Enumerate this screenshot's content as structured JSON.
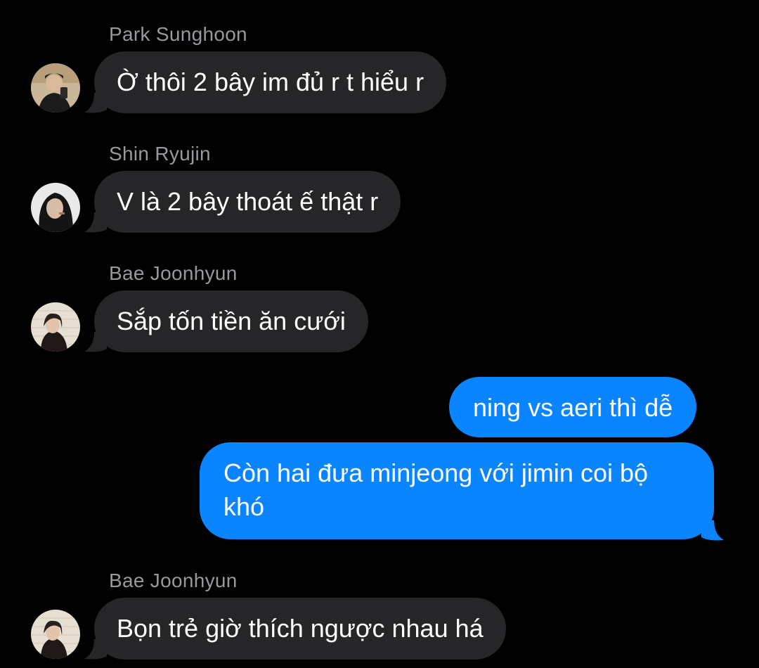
{
  "messages": [
    {
      "sender": "Park Sunghoon",
      "text": "Ờ thôi 2 bây im đủ r t hiểu r",
      "avatar": "avatar-park-sunghoon"
    },
    {
      "sender": "Shin Ryujin",
      "text": "V là 2 bây thoát ế thật r",
      "avatar": "avatar-shin-ryujin"
    },
    {
      "sender": "Bae Joonhyun",
      "text": "Sắp tốn tiền ăn cưới",
      "avatar": "avatar-bae-joonhyun"
    },
    {
      "outgoing": true,
      "text": "ning vs aeri thì dễ"
    },
    {
      "outgoing": true,
      "lines": [
        "Còn hai đưa minjeong với jimin coi bộ",
        "khó"
      ]
    },
    {
      "sender": "Bae Joonhyun",
      "text": "Bọn trẻ giờ thích ngược nhau há",
      "avatar": "avatar-bae-joonhyun"
    }
  ],
  "colors": {
    "background": "#000000",
    "incoming_bubble": "#262629",
    "outgoing_bubble": "#0a84ff",
    "sender_name": "#98989e",
    "text": "#ffffff"
  }
}
